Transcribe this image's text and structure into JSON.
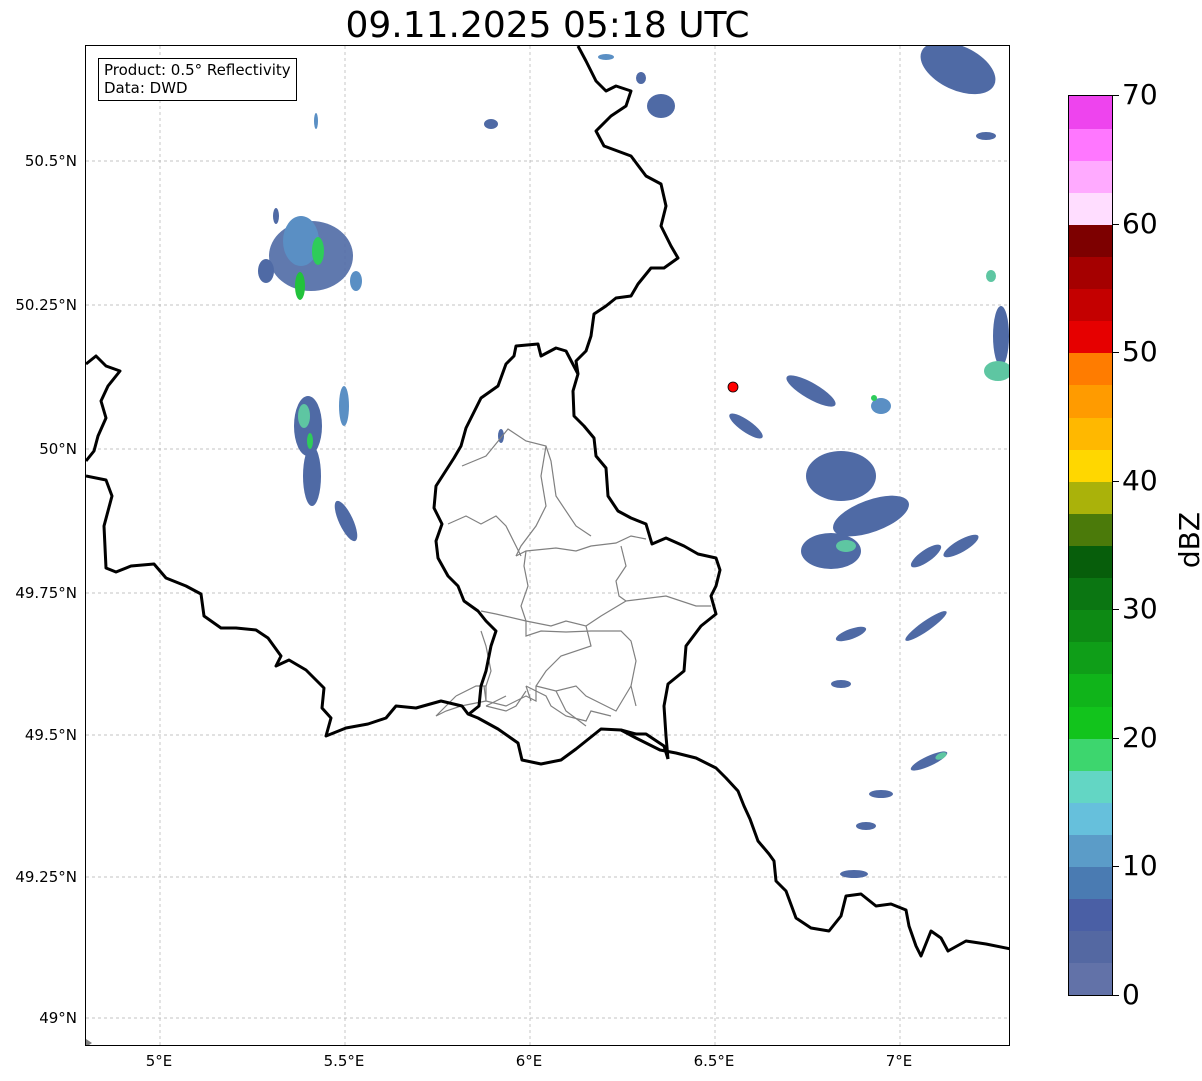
{
  "title": "09.11.2025 05:18 UTC",
  "info": {
    "product_line": "Product: 0.5° Reflectivity",
    "data_line": "Data: DWD"
  },
  "axes": {
    "lat_labels": [
      "50.5°N",
      "50.25°N",
      "50°N",
      "49.75°N",
      "49.5°N",
      "49.25°N",
      "49°N"
    ],
    "lon_labels": [
      "5°E",
      "5.5°E",
      "6°E",
      "6.5°E",
      "7°E"
    ]
  },
  "marker": {
    "color": "#ff0000"
  },
  "colorbar": {
    "label": "dBZ",
    "min": 0,
    "max": 70,
    "tick_labels": [
      "0",
      "10",
      "20",
      "30",
      "40",
      "50",
      "60",
      "70"
    ],
    "colors": [
      "#6272a8",
      "#5468a2",
      "#4a5fa5",
      "#4a7bb2",
      "#5b9cc8",
      "#66c0dc",
      "#63d6c4",
      "#3dd66e",
      "#12c41c",
      "#10b41a",
      "#0f9e18",
      "#0d8a14",
      "#0b7612",
      "#075e0b",
      "#4b7a0a",
      "#aab20a",
      "#ffd700",
      "#ffb800",
      "#ff9b00",
      "#ff7c00",
      "#e60000",
      "#c40000",
      "#a50000",
      "#7d0000",
      "#ffddff",
      "#ffaaff",
      "#ff77ff",
      "#ee44ee"
    ]
  }
}
